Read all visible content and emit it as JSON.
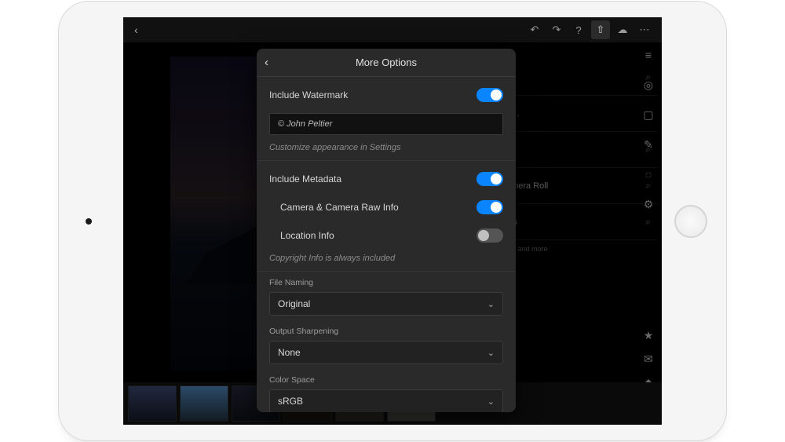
{
  "popover": {
    "title": "More Options",
    "watermark": {
      "label": "Include Watermark",
      "value": "© John Peltier",
      "hint": "Customize appearance in Settings",
      "enabled": true
    },
    "metadata": {
      "label": "Include Metadata",
      "enabled": true,
      "camera": {
        "label": "Camera & Camera Raw Info",
        "enabled": true
      },
      "location": {
        "label": "Location Info",
        "enabled": false
      },
      "hint": "Copyright Info is always included"
    },
    "file_naming": {
      "label": "File Naming",
      "value": "Original"
    },
    "output_sharpening": {
      "label": "Output Sharpening",
      "value": "None"
    },
    "color_space": {
      "label": "Color Space",
      "value": "sRGB"
    }
  },
  "share_bg": {
    "rows": [
      {
        "label": "e…"
      },
      {
        "label": "amera Roll"
      },
      {
        "label": "les"
      }
    ],
    "desc": "ing and more"
  },
  "icons": {
    "back": "‹",
    "chevron_down": "⌄",
    "undo": "↶",
    "redo": "↷",
    "help": "?",
    "share": "⇧",
    "cloud": "☁",
    "more": "⋯",
    "sliders": "≡",
    "target": "◎",
    "crop": "▢",
    "brush": "✎",
    "dots": "◌",
    "adjust": "⚙",
    "star": "★",
    "comment": "✉",
    "tag": "◆",
    "info": "ⓘ",
    "toggle_pair": "⌕"
  }
}
